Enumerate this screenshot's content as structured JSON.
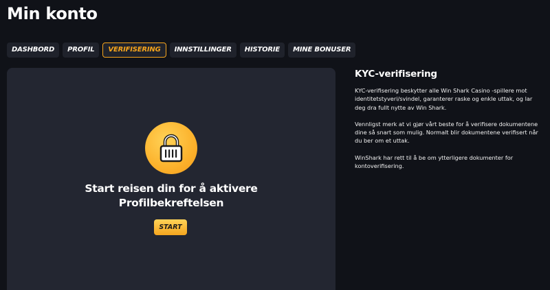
{
  "page": {
    "title": "Min konto"
  },
  "tabs": [
    {
      "label": "DASHBORD",
      "active": false
    },
    {
      "label": "PROFIL",
      "active": false
    },
    {
      "label": "VERIFISERING",
      "active": true
    },
    {
      "label": "INNSTILLINGER",
      "active": false
    },
    {
      "label": "HISTORIE",
      "active": false
    },
    {
      "label": "MINE BONUSER",
      "active": false
    }
  ],
  "card": {
    "icon": "lock-icon",
    "heading_line1": "Start reisen din for å aktivere",
    "heading_line2": "Profilbekreftelsen",
    "start_label": "START"
  },
  "info": {
    "title": "KYC-verifisering",
    "paragraphs": [
      "KYC-verifisering beskytter alle Win Shark Casino -spillere mot identitetstyveri/svindel, garanterer raske og enkle uttak, og lar deg dra fullt nytte av Win Shark.",
      "Vennligst merk at vi gjør vårt beste for å verifisere dokumentene dine så snart som mulig. Normalt blir dokumentene verifisert når du ber om et uttak.",
      "WinShark har rett til å be om ytterligere dokumenter for kontoverifisering."
    ]
  },
  "colors": {
    "background": "#101218",
    "card": "#232631",
    "tab": "#1f222b",
    "accent": "#f7a51c"
  }
}
